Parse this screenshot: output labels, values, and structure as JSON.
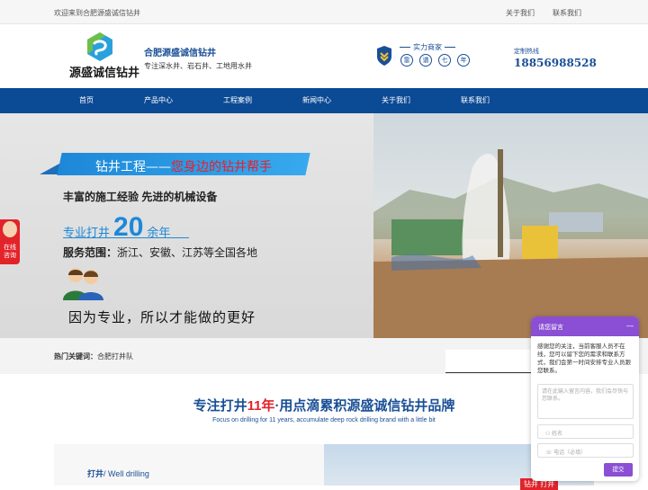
{
  "topbar": {
    "welcome": "欢迎来到合肥源盛诚信钻井",
    "links": [
      "关于我们",
      "联系我们"
    ]
  },
  "header": {
    "logo_text": "源盛诚信钻井",
    "company_name": "合肥源盛诚信钻井",
    "company_sub": "专注深水井、岩石井、工地用水井",
    "badge_title": "实力商家",
    "badge_chars": [
      "靠",
      "谱",
      "七",
      "年"
    ],
    "hotline_label": "定制热线",
    "hotline_number": "18856988528"
  },
  "nav": {
    "items": [
      "首页",
      "产品中心",
      "工程案例",
      "新闻中心",
      "关于我们",
      "联系我们"
    ]
  },
  "banner": {
    "slogan_prefix": "钻井工程——",
    "slogan_highlight": "您身边的钻井帮手",
    "line1": "丰富的施工经验  先进的机械设备",
    "exp_prefix": "专业打井",
    "exp_years": "20",
    "exp_suffix": "余年",
    "range_label": "服务范围：",
    "range_value": "浙江、安徽、江苏等全国各地",
    "motto": "因为专业，所以才能做的更好"
  },
  "side_button": {
    "label_1": "在线",
    "label_2": "咨询"
  },
  "keywords": {
    "label": "热门关键词：",
    "value": "合肥打井队"
  },
  "section": {
    "title_a": "专注打井",
    "title_red": "11年",
    "title_b": "·用点滴累积源盛诚信钻井品牌",
    "subtitle": "Focus on drilling for 11 years, accumulate deep rock drilling brand with a little bit"
  },
  "card": {
    "title_cn": "打井",
    "title_en": "/ Well drilling",
    "tag": "钻井 打井"
  },
  "chat": {
    "title": "请您留言",
    "minimize": "—",
    "message": "感谢您的关注，当前客服人员不在线，您可以留下您的需求和联系方式，我们会第一时间安排专业人员跟您联系。",
    "textarea_placeholder": "请在此输入留言内容，我们会尽快与您联系。",
    "name_placeholder": "姓名",
    "phone_placeholder": "电话（必填）",
    "submit_label": "提交"
  },
  "colors": {
    "brand_blue": "#0b4a94",
    "accent_red": "#e3232a",
    "chat_purple": "#8a4fd4"
  }
}
